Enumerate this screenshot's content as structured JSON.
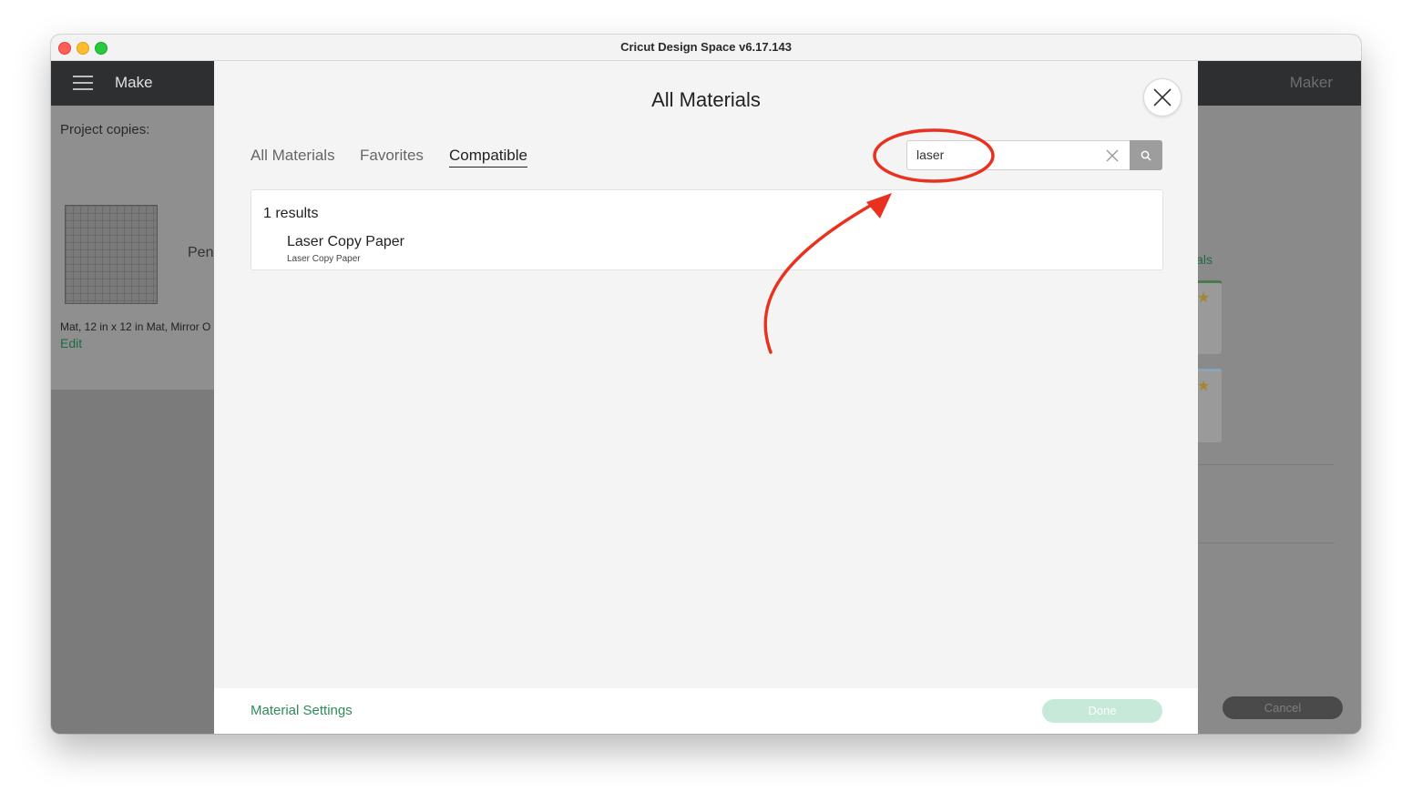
{
  "window": {
    "title": "Cricut Design Space  v6.17.143"
  },
  "header": {
    "menu_label": "Make",
    "machine_label": "Maker"
  },
  "left_panel": {
    "project_copies_label": "Project copies:",
    "pen_label": "Pen",
    "mat_description": "Mat, 12 in x 12 in Mat, Mirror O",
    "edit_label": "Edit"
  },
  "right_panel": {
    "materials_fragment": "ials",
    "cancel_label": "Cancel"
  },
  "modal": {
    "title": "All Materials",
    "tabs": [
      {
        "label": "All Materials",
        "active": false
      },
      {
        "label": "Favorites",
        "active": false
      },
      {
        "label": "Compatible",
        "active": true
      }
    ],
    "search": {
      "value": "laser"
    },
    "results": {
      "count_label": "1 results",
      "items": [
        {
          "name": "Laser Copy Paper",
          "subtitle": "Laser Copy Paper"
        }
      ]
    },
    "footer": {
      "settings_label": "Material Settings",
      "done_label": "Done"
    }
  },
  "colors": {
    "accent_green": "#2e8b57",
    "done_disabled": "#c7e9da",
    "annotation_red": "#e8321f"
  }
}
